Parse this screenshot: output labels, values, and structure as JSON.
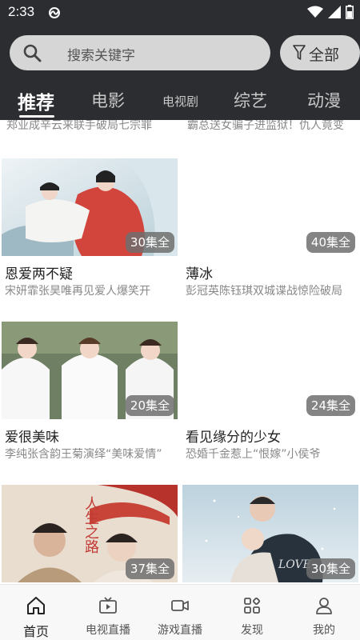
{
  "status_bar": {
    "time": "2:33"
  },
  "search": {
    "placeholder": "搜索关键字"
  },
  "filter": {
    "label": "全部"
  },
  "tabs": [
    {
      "label": "推荐",
      "active": true
    },
    {
      "label": "电影"
    },
    {
      "label": "电视剧"
    },
    {
      "label": "综艺"
    },
    {
      "label": "动漫"
    }
  ],
  "cut_rows": {
    "left": "郑业成辛云来联手破局七宗罪",
    "right": "霸总送女骗子进监狱！仇人竟变"
  },
  "cards": [
    {
      "title": "恩爱两不疑",
      "sub": "宋妍霏张昊唯再见爱人爆笑开",
      "badge": "30集全"
    },
    {
      "title": "薄冰",
      "sub": "彭冠英陈钰琪双城谍战惊险破局",
      "badge": "40集全"
    },
    {
      "title": "爱很美味",
      "sub": "李纯张含韵王菊演绎“美味爱情”",
      "badge": "20集全"
    },
    {
      "title": "看见缘分的少女",
      "sub": "恐婚千金惹上“恨嫁”小侯爷",
      "badge": "24集全"
    },
    {
      "title": "",
      "sub": "",
      "badge": "37集全",
      "poster_text": "人生之路"
    },
    {
      "title": "",
      "sub": "",
      "badge": "30集全",
      "poster_text": "LOVE"
    }
  ],
  "bottom_nav": [
    {
      "label": "首页",
      "icon": "home-icon",
      "active": true
    },
    {
      "label": "电视直播",
      "icon": "tv-icon"
    },
    {
      "label": "游戏直播",
      "icon": "video-camera-icon"
    },
    {
      "label": "发现",
      "icon": "grid-icon"
    },
    {
      "label": "我的",
      "icon": "user-icon"
    }
  ]
}
